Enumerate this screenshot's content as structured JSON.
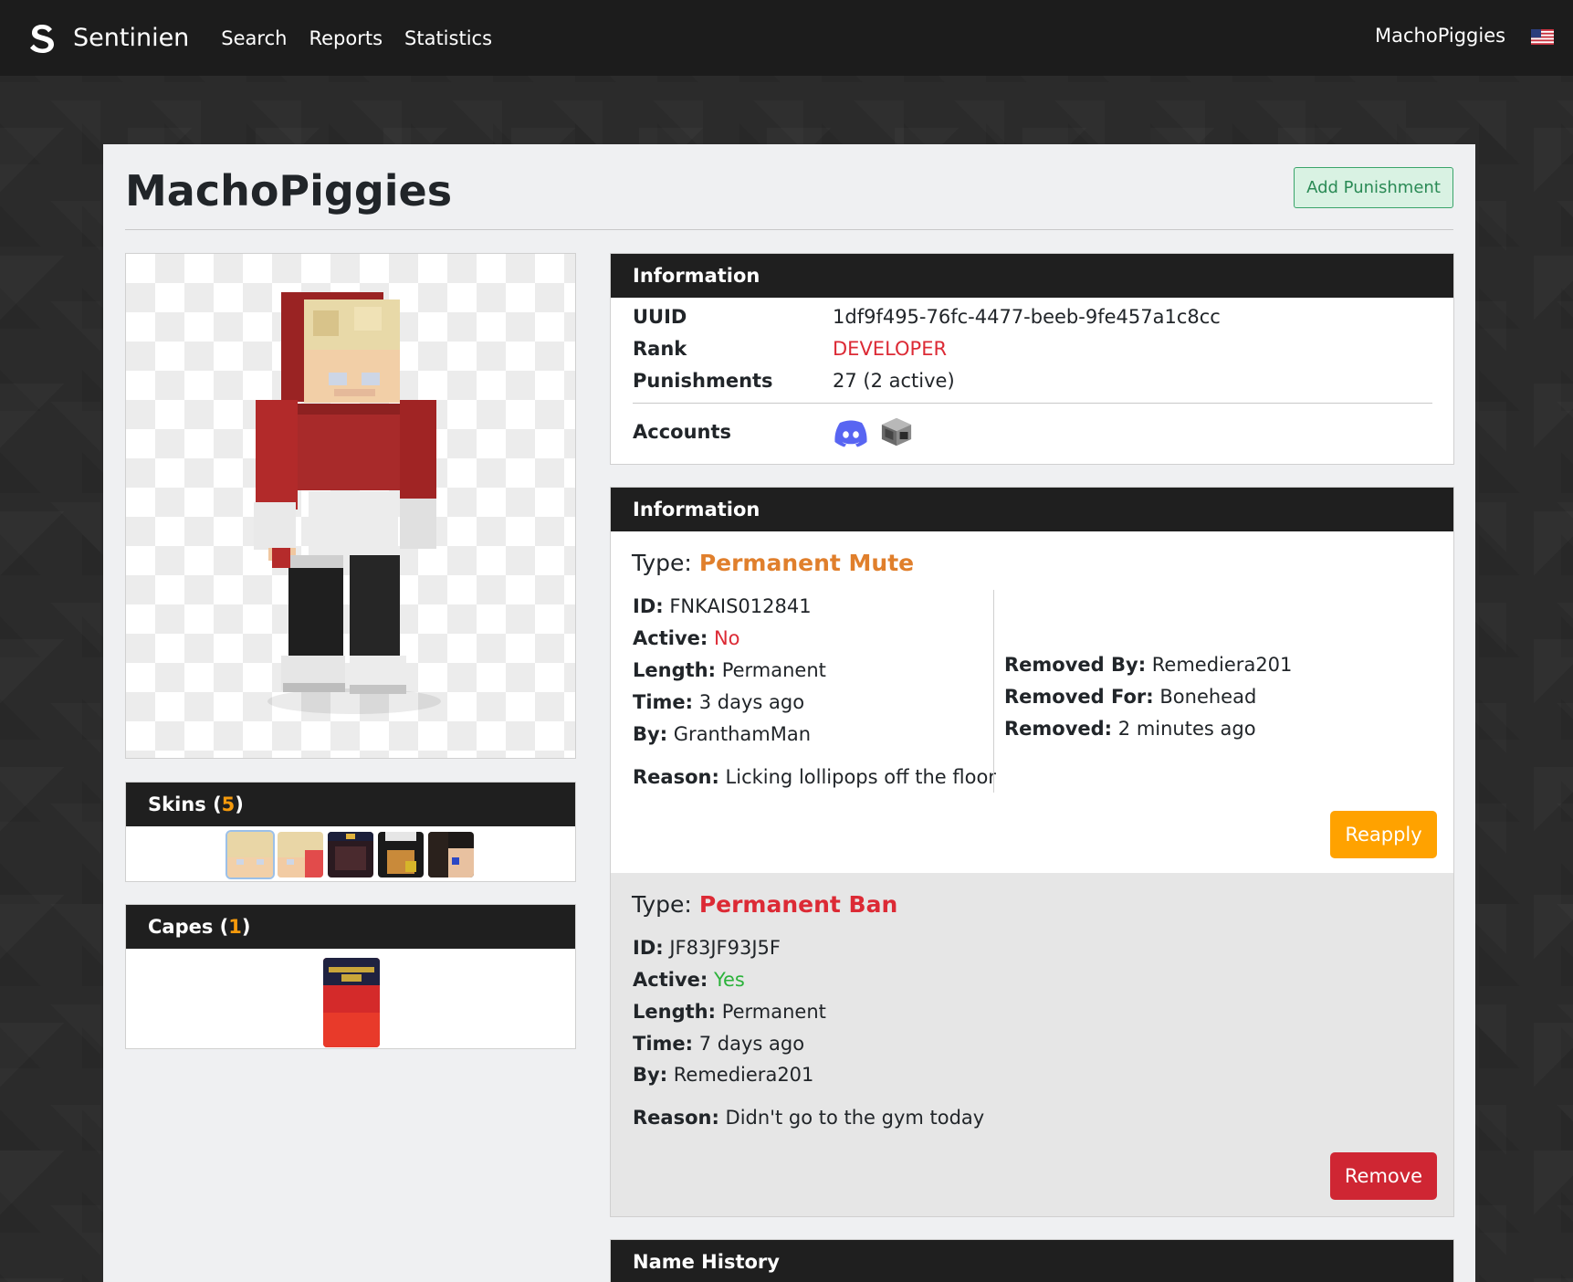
{
  "navbar": {
    "brand": "Sentinien",
    "links": [
      "Search",
      "Reports",
      "Statistics"
    ],
    "user": "MachoPiggies",
    "flag_icon": "us-flag-icon"
  },
  "page": {
    "title": "MachoPiggies",
    "add_punishment_label": "Add Punishment"
  },
  "skins": {
    "label": "Skins",
    "count_open": "(",
    "count": "5",
    "count_close": ")"
  },
  "capes": {
    "label": "Capes",
    "count_open": "(",
    "count": "1",
    "count_close": ")"
  },
  "information": {
    "header": "Information",
    "uuid_label": "UUID",
    "uuid": "1df9f495-76fc-4477-beeb-9fe457a1c8cc",
    "rank_label": "Rank",
    "rank": "DEVELOPER",
    "punishments_label": "Punishments",
    "punishments": "27 (2 active)",
    "accounts_label": "Accounts",
    "accounts": [
      "discord-icon",
      "minecraft-block-icon"
    ]
  },
  "punishments": {
    "header": "Information",
    "items": [
      {
        "type_label": "Type:",
        "type": "Permanent Mute",
        "id_label": "ID:",
        "id": "FNKAIS012841",
        "active_label": "Active:",
        "active": "No",
        "length_label": "Length:",
        "length": "Permanent",
        "time_label": "Time:",
        "time": "3 days ago",
        "by_label": "By:",
        "by": "GranthamMan",
        "reason_label": "Reason:",
        "reason": "Licking lollipops off the floor",
        "removed_by_label": "Removed By:",
        "removed_by": "Remediera201",
        "removed_for_label": "Removed For:",
        "removed_for": "Bonehead",
        "removed_label": "Removed:",
        "removed": "2 minutes ago",
        "action": "Reapply"
      },
      {
        "type_label": "Type:",
        "type": "Permanent Ban",
        "id_label": "ID:",
        "id": "JF83JF93J5F",
        "active_label": "Active:",
        "active": "Yes",
        "length_label": "Length:",
        "length": "Permanent",
        "time_label": "Time:",
        "time": "7 days ago",
        "by_label": "By:",
        "by": "Remediera201",
        "reason_label": "Reason:",
        "reason": "Didn't go to the gym today",
        "action": "Remove"
      }
    ]
  },
  "name_history": {
    "header": "Name History"
  },
  "colors": {
    "navbar": "#1c1c1c",
    "rank": "#dc2a35",
    "mute": "#e07f2c",
    "ban": "#dc2a35",
    "active_yes": "#2bb23a",
    "active_no": "#dc2a35",
    "reapply": "#ffa200",
    "remove": "#cf2633",
    "count": "#f59a0c"
  }
}
